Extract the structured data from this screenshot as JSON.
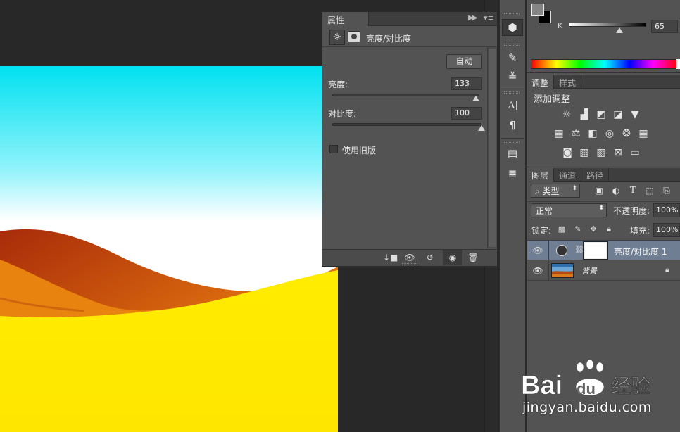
{
  "properties_panel": {
    "tab_label": "属性",
    "title": "亮度/对比度",
    "auto_button": "自动",
    "brightness": {
      "label": "亮度:",
      "value": "133",
      "slider_fraction": 0.98
    },
    "contrast": {
      "label": "对比度:",
      "value": "100",
      "slider_fraction": 1.0
    },
    "legacy_checkbox": {
      "label": "使用旧版",
      "checked": false
    },
    "footer_icons": [
      "clip-to-layer-icon",
      "view-previous-icon",
      "reset-icon",
      "visibility-icon",
      "delete-icon"
    ]
  },
  "color_panel": {
    "channel_label": "K",
    "channel_value": "65",
    "fg_color": "#868686",
    "bg_color": "#000000"
  },
  "adjustments_panel": {
    "tabs": [
      {
        "label": "调整",
        "active": true
      },
      {
        "label": "样式",
        "active": false
      }
    ],
    "add_label": "添加调整",
    "icon_rows": [
      [
        "brightness-icon",
        "levels-icon",
        "curves-icon",
        "exposure-icon",
        "gradient-map-triangle-icon"
      ],
      [
        "vibrance-icon",
        "color-balance-icon",
        "black-white-icon",
        "photo-filter-icon",
        "channel-mixer-icon",
        "color-lookup-icon"
      ],
      [
        "invert-icon",
        "posterize-icon",
        "threshold-icon",
        "selective-color-icon",
        "gradient-map-icon"
      ]
    ]
  },
  "layers_panel": {
    "tabs": [
      {
        "label": "图层",
        "active": true
      },
      {
        "label": "通道",
        "active": false
      },
      {
        "label": "路径",
        "active": false
      }
    ],
    "filter_kind": "类型",
    "blend_mode": "正常",
    "opacity_label": "不透明度:",
    "opacity_value": "100%",
    "lock_label": "锁定:",
    "fill_label": "填充:",
    "fill_value": "100%",
    "layers": [
      {
        "name": "亮度/对比度 1",
        "selected": true,
        "type": "adjustment"
      },
      {
        "name": "背景",
        "selected": false,
        "type": "image",
        "locked": true
      }
    ]
  },
  "watermark": {
    "logo_text": "Bai",
    "logo_text2": "du",
    "logo_cn": "经验",
    "url": "jingyan.baidu.com"
  },
  "colors": {
    "sky": "#00e5f5",
    "sand": "#ffee00",
    "dune": "#c2410c",
    "selected_layer": "#6f7e93"
  }
}
